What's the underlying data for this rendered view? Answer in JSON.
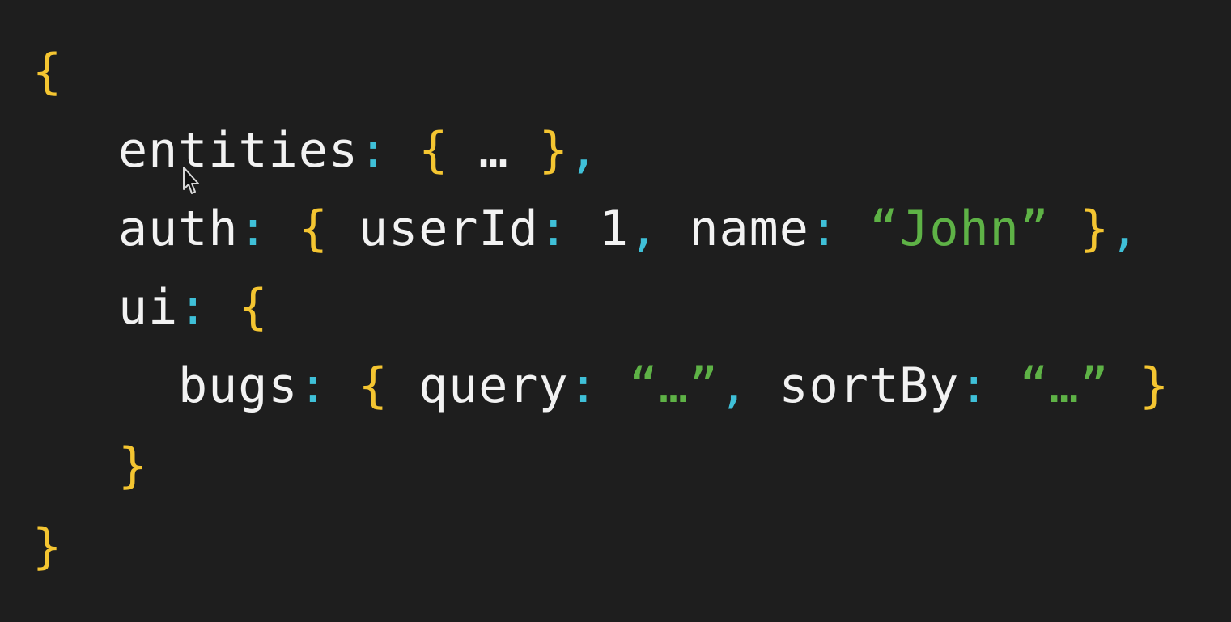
{
  "editor": {
    "theme_colors": {
      "background": "#1e1e1e",
      "identifier": "#f2f2f2",
      "punctuation": "#3fc0d8",
      "brace": "#f4c531",
      "string": "#5eb246"
    },
    "lines": [
      {
        "tokens": [
          {
            "text": "{",
            "kind": "brace"
          }
        ]
      },
      {
        "tokens": [
          {
            "text": "entities",
            "kind": "ident"
          },
          {
            "text": ":",
            "kind": "punct"
          },
          {
            "text": " ",
            "kind": "ident"
          },
          {
            "text": "{",
            "kind": "brace"
          },
          {
            "text": " … ",
            "kind": "ident"
          },
          {
            "text": "}",
            "kind": "brace"
          },
          {
            "text": ",",
            "kind": "punct"
          }
        ]
      },
      {
        "tokens": [
          {
            "text": "auth",
            "kind": "ident"
          },
          {
            "text": ":",
            "kind": "punct"
          },
          {
            "text": " ",
            "kind": "ident"
          },
          {
            "text": "{",
            "kind": "brace"
          },
          {
            "text": " userId",
            "kind": "ident"
          },
          {
            "text": ":",
            "kind": "punct"
          },
          {
            "text": " 1",
            "kind": "number"
          },
          {
            "text": ",",
            "kind": "punct"
          },
          {
            "text": " name",
            "kind": "ident"
          },
          {
            "text": ":",
            "kind": "punct"
          },
          {
            "text": " ",
            "kind": "ident"
          },
          {
            "text": "“John”",
            "kind": "string"
          },
          {
            "text": " ",
            "kind": "ident"
          },
          {
            "text": "}",
            "kind": "brace"
          },
          {
            "text": ",",
            "kind": "punct"
          }
        ]
      },
      {
        "tokens": [
          {
            "text": "ui",
            "kind": "ident"
          },
          {
            "text": ":",
            "kind": "punct"
          },
          {
            "text": " ",
            "kind": "ident"
          },
          {
            "text": "{",
            "kind": "brace"
          }
        ]
      },
      {
        "tokens": [
          {
            "text": "bugs",
            "kind": "ident"
          },
          {
            "text": ":",
            "kind": "punct"
          },
          {
            "text": " ",
            "kind": "ident"
          },
          {
            "text": "{",
            "kind": "brace"
          },
          {
            "text": " query",
            "kind": "ident"
          },
          {
            "text": ":",
            "kind": "punct"
          },
          {
            "text": " ",
            "kind": "ident"
          },
          {
            "text": "“…”",
            "kind": "string"
          },
          {
            "text": ",",
            "kind": "punct"
          },
          {
            "text": " sortBy",
            "kind": "ident"
          },
          {
            "text": ":",
            "kind": "punct"
          },
          {
            "text": " ",
            "kind": "ident"
          },
          {
            "text": "“…”",
            "kind": "string"
          },
          {
            "text": " ",
            "kind": "ident"
          },
          {
            "text": "}",
            "kind": "brace"
          }
        ]
      },
      {
        "tokens": [
          {
            "text": "}",
            "kind": "brace"
          }
        ]
      },
      {
        "tokens": [
          {
            "text": "}",
            "kind": "brace"
          }
        ]
      }
    ]
  },
  "cursor": {
    "icon": "mouse-pointer-icon"
  }
}
